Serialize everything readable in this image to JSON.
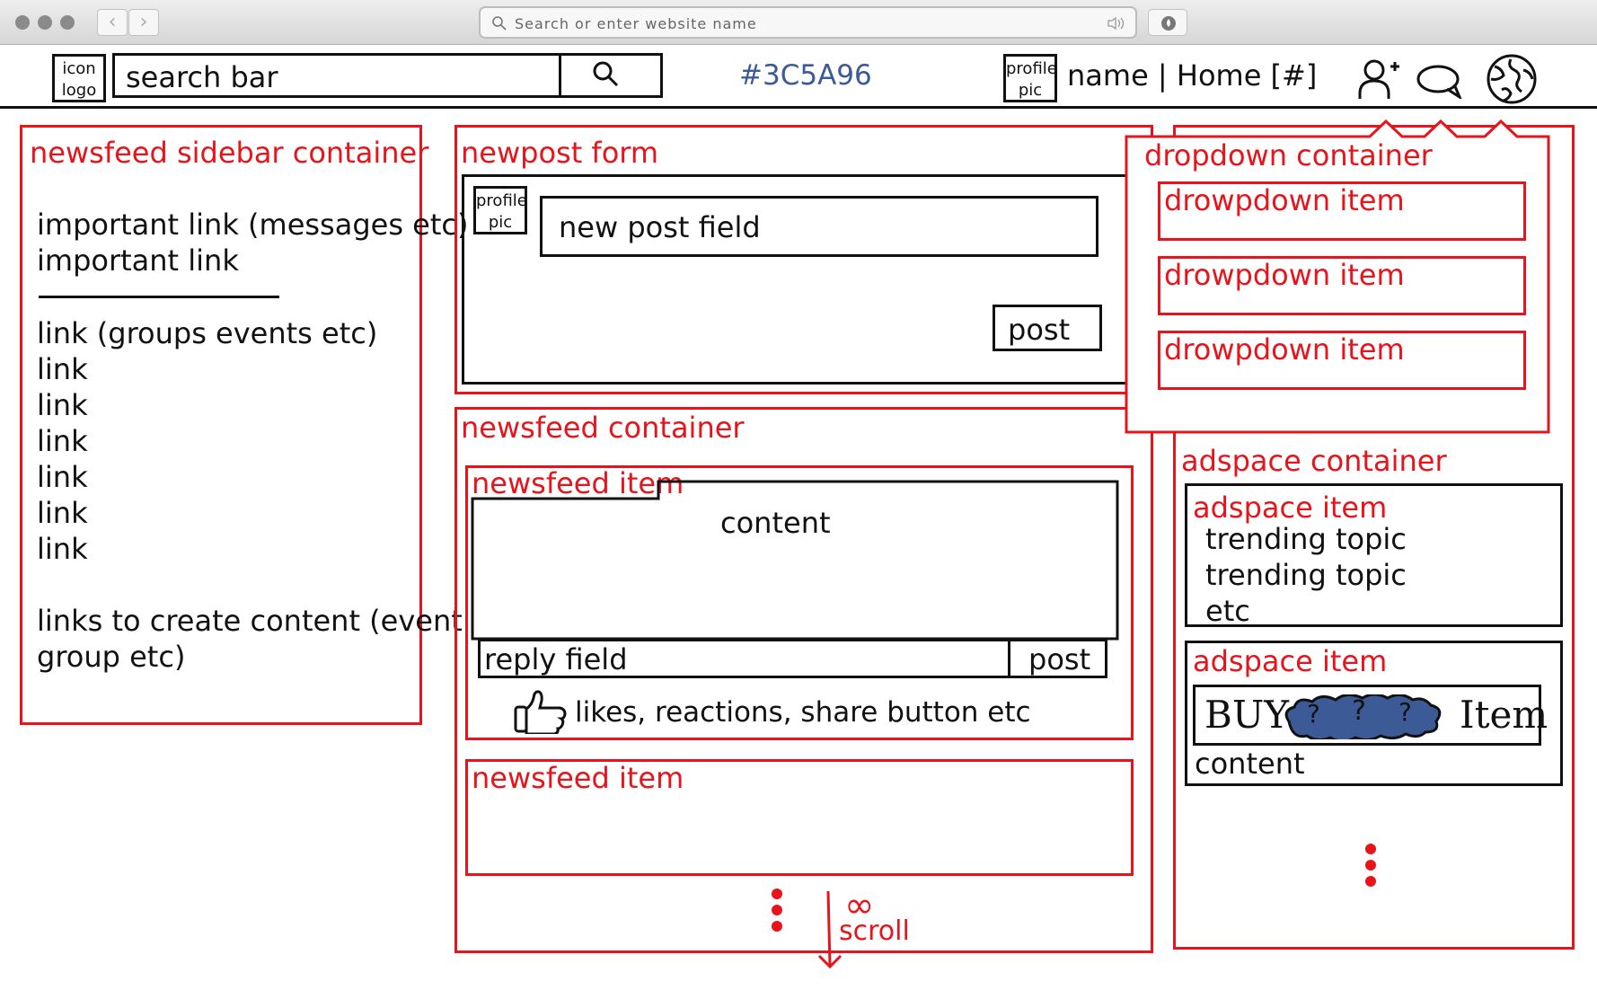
{
  "browser": {
    "url_placeholder": "Search or enter website name",
    "back_label": "‹",
    "forward_label": "›"
  },
  "header": {
    "logo_line1": "icon",
    "logo_line2": "logo",
    "search_placeholder": "search bar",
    "color_code": "#3C5A96",
    "profile_line1": "profile",
    "profile_line2": "pic",
    "user_nav": "name | Home [#]"
  },
  "sidebar": {
    "title": "newsfeed sidebar container",
    "important_links": [
      "important link (messages etc)",
      "important link"
    ],
    "links": [
      "link (groups events etc)",
      "link",
      "link",
      "link",
      "link",
      "link",
      "link"
    ],
    "create_line1": "links to create content (event",
    "create_line2": "group etc)"
  },
  "newpost": {
    "title": "newpost form",
    "profile_line1": "profile",
    "profile_line2": "pic",
    "field_label": "new post field",
    "post_button": "post"
  },
  "newsfeed": {
    "title": "newsfeed container",
    "item1_title": "newsfeed item",
    "item1_content": "content",
    "reply_field": "reply field",
    "reply_post": "post",
    "reactions": "likes, reactions, share button etc",
    "item2_title": "newsfeed item",
    "scroll_label": "scroll",
    "infinity": "∞"
  },
  "dropdown": {
    "title": "dropdown container",
    "items": [
      "drowpdown item",
      "drowpdown item",
      "drowpdown item"
    ]
  },
  "adspace": {
    "title": "adspace container",
    "item1_title": "adspace item",
    "topics": [
      "trending topic",
      "trending topic",
      "etc"
    ],
    "item2_title": "adspace item",
    "buy_word": "BUY",
    "item_word": "Item",
    "mystery": "?",
    "item2_content": "content"
  },
  "colors": {
    "wireframe_red": "#e8141b",
    "brand_blue": "#3C5A96",
    "line_black": "#111111"
  }
}
